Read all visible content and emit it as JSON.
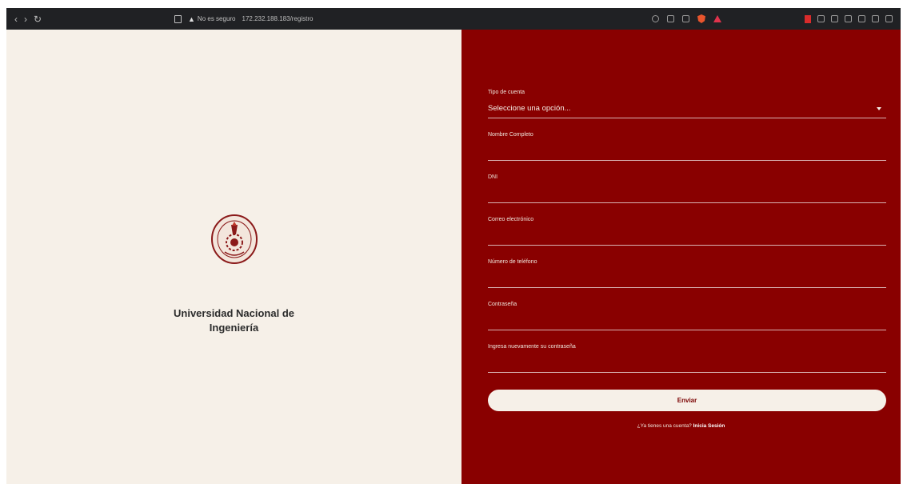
{
  "browser": {
    "security_warning": "No es seguro",
    "url": "172.232.188.183/registro",
    "icons": [
      "back-icon",
      "forward-icon",
      "reload-icon",
      "bookmark-icon",
      "warning-icon",
      "zoom-icon",
      "key-icon",
      "share-icon",
      "brave-shield-icon",
      "rewards-icon",
      "extension-icon",
      "sidebar-icon",
      "window-icon"
    ]
  },
  "brand": {
    "name_line1": "Universidad Nacional de",
    "name_line2": "Ingeniería",
    "seal_color": "#8b1a1a"
  },
  "form": {
    "fields": [
      {
        "label": "Tipo de cuenta",
        "value": "Seleccione una opción..."
      },
      {
        "label": "Nombre Completo",
        "value": ""
      },
      {
        "label": "DNI",
        "value": ""
      },
      {
        "label": "Correo electrónico",
        "value": ""
      },
      {
        "label": "Número de teléfono",
        "value": ""
      },
      {
        "label": "Contraseña",
        "value": ""
      },
      {
        "label": "Ingresa nuevamente su contraseña",
        "value": ""
      }
    ],
    "submit_label": "Enviar",
    "login_prompt": "¿Ya tienes una cuenta?",
    "login_link": "Inicia Sesión"
  },
  "colors": {
    "panel_red": "#890000",
    "panel_cream": "#f6f0e8",
    "button_text": "#7a0000"
  }
}
